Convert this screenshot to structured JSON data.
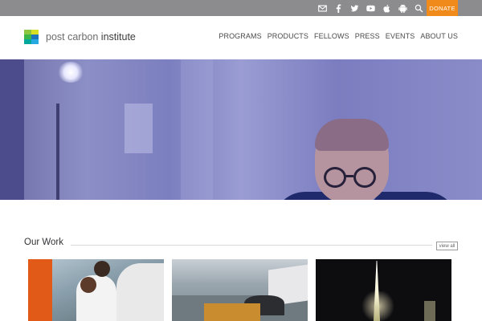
{
  "topbar": {
    "icons": [
      "mail-icon",
      "facebook-icon",
      "twitter-icon",
      "youtube-icon",
      "apple-icon",
      "android-icon",
      "search-icon"
    ],
    "donate_label": "DONATE",
    "colors": {
      "bar": "#8c8b8e",
      "donate": "#f08a1a"
    }
  },
  "header": {
    "logo": {
      "part1": "post carbon ",
      "part2": "institute"
    },
    "nav": [
      "PROGRAMS",
      "PRODUCTS",
      "FELLOWS",
      "PRESS",
      "EVENTS",
      "ABOUT US"
    ]
  },
  "hero": {
    "image": "man-with-round-glasses-speaking"
  },
  "our_work": {
    "title": "Our Work",
    "view_all": "view all",
    "cards": [
      {
        "image": "people-working-outdoors"
      },
      {
        "image": "ship-and-rescue-boat"
      },
      {
        "image": "oil-rig-at-night"
      }
    ]
  }
}
